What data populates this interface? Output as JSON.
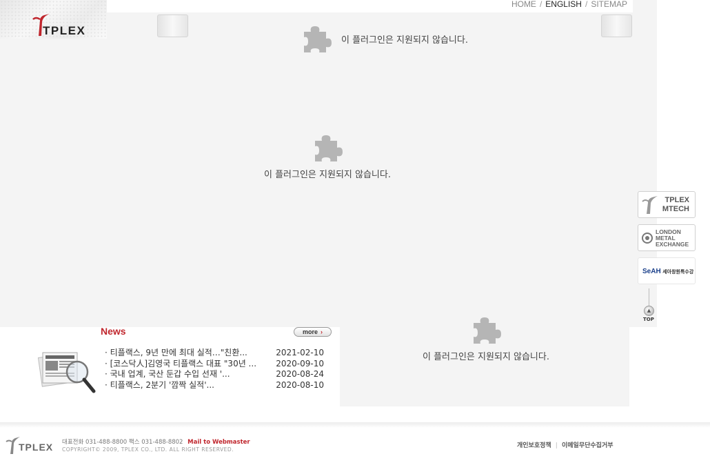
{
  "brand": {
    "logo_text": "TPLEX"
  },
  "topnav": {
    "home": "HOME",
    "english": "ENGLISH",
    "sitemap": "SITEMAP",
    "sep": "/"
  },
  "plugin": {
    "message_top": "이 플러그인은 지원되지 않습니다.",
    "message_mid": "이 플러그인은 지원되지 않습니다.",
    "message_bottom": "이 플러그인은 지원되지 않습니다.",
    "icon": "puzzle-piece-icon"
  },
  "news": {
    "title": "News",
    "more_label": "more",
    "items": [
      {
        "title": "· 티플랙스, 9년 만에 최대 실적…\"친환...",
        "date": "2021-02-10"
      },
      {
        "title": "· [코스닥人]김영국 티플랙스 대표 \"30년 ...",
        "date": "2020-09-10"
      },
      {
        "title": "· 국내 업계, 국산 둔갑 수입 선재 '...",
        "date": "2020-08-24"
      },
      {
        "title": "· 티플랙스, 2분기 '깜짝 실적'...",
        "date": "2020-08-10"
      }
    ]
  },
  "side": {
    "mtech_line1": "TPLEX",
    "mtech_line2": "MTECH",
    "lme_line1": "LONDON",
    "lme_line2": "METAL",
    "lme_line3": "EXCHANGE",
    "seah_brand": "SeAH",
    "seah_sub": "세아창원특수강",
    "top_label": "TOP"
  },
  "footer": {
    "logo_text": "TPLEX",
    "info": "대표전화 031-488-8800  팩스 031-488-8802",
    "mail": "Mail to Webmaster",
    "copyright": "COPYRIGHT© 2009, TPLEX CO., LTD. ALL RIGHT RESERVED.",
    "privacy": "개인보호정책",
    "email_refuse": "이메일무단수집거부",
    "sep": "|"
  },
  "colors": {
    "accent_red": "#c0262d",
    "panel_gray": "#f4f4f4"
  }
}
